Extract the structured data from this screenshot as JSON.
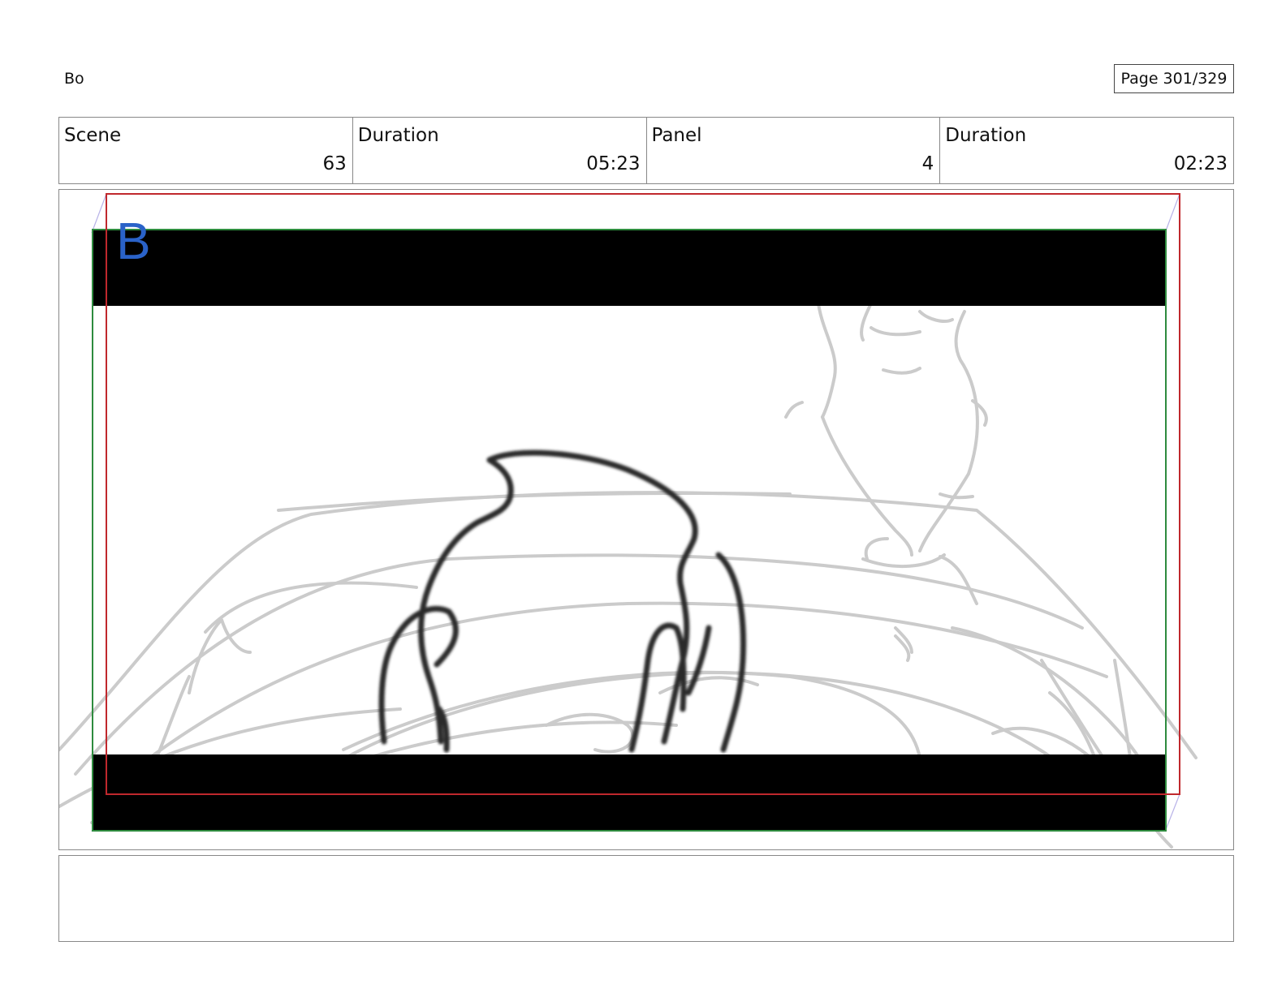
{
  "header": {
    "project_title": "Bo",
    "page_label": "Page 301/329"
  },
  "info": {
    "scene_label": "Scene",
    "scene_value": "63",
    "scene_duration_label": "Duration",
    "scene_duration_value": "05:23",
    "panel_label": "Panel",
    "panel_value": "4",
    "panel_duration_label": "Duration",
    "panel_duration_value": "02:23"
  },
  "panel": {
    "layer_letter": "B",
    "colors": {
      "letter": "#2a62c8",
      "safe_frame": "#c0282d",
      "camera_frame": "#2e8b3e",
      "guide_lines": "#b8b2e8",
      "sketch_light": "#c9c9c9",
      "sketch_dark": "#2a2a2a",
      "letterbox": "#000000"
    }
  },
  "notes": {
    "text": ""
  }
}
